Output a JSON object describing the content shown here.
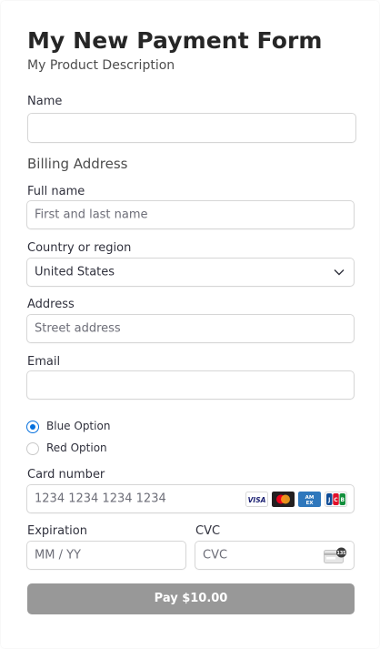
{
  "form": {
    "title": "My New Payment Form",
    "description": "My Product Description"
  },
  "name_field": {
    "label": "Name",
    "value": ""
  },
  "billing": {
    "heading": "Billing Address",
    "full_name_label": "Full name",
    "full_name_placeholder": "First and last name",
    "country_label": "Country or region",
    "country_value": "United States",
    "address_label": "Address",
    "address_placeholder": "Street address"
  },
  "email_field": {
    "label": "Email",
    "value": ""
  },
  "options": [
    {
      "label": "Blue Option",
      "checked": true
    },
    {
      "label": "Red Option",
      "checked": false
    }
  ],
  "card": {
    "number_label": "Card number",
    "number_placeholder": "1234 1234 1234 1234",
    "brand_icons": [
      "visa-icon",
      "mastercard-icon",
      "amex-icon",
      "jcb-icon"
    ],
    "expiration_label": "Expiration",
    "expiration_placeholder": "MM / YY",
    "cvc_label": "CVC",
    "cvc_placeholder": "CVC",
    "cvc_icon_text": "135"
  },
  "pay_button": {
    "label": "Pay $10.00",
    "color": "#989898"
  },
  "colors": {
    "accent": "#0570de",
    "text": "#30313d",
    "placeholder": "#6d6e78"
  }
}
